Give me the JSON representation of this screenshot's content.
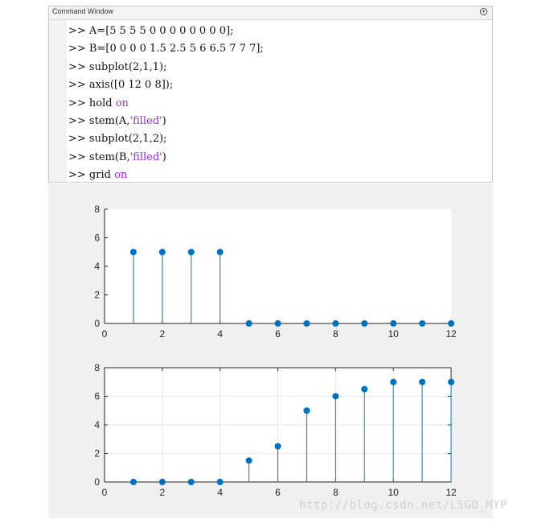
{
  "command_window": {
    "title": "Command Window",
    "menu_icon": "circle-chevron-down-icon",
    "prompt": ">>",
    "lines": [
      [
        {
          "t": "A=[5 5 5 5 0 0 0 0 0 0 0 0];",
          "c": "code"
        }
      ],
      [
        {
          "t": "B=[0 0 0 0 1.5 2.5 5 6 6.5 7 7 7];",
          "c": "code"
        }
      ],
      [
        {
          "t": "subplot(2,1,1);",
          "c": "code"
        }
      ],
      [
        {
          "t": "axis([0 12 0 8]);",
          "c": "code"
        }
      ],
      [
        {
          "t": "hold ",
          "c": "code"
        },
        {
          "t": "on",
          "c": "kw"
        }
      ],
      [
        {
          "t": "stem(A,",
          "c": "code"
        },
        {
          "t": "'filled'",
          "c": "str"
        },
        {
          "t": ")",
          "c": "code"
        }
      ],
      [
        {
          "t": "subplot(2,1,2);",
          "c": "code"
        }
      ],
      [
        {
          "t": "stem(B,",
          "c": "code"
        },
        {
          "t": "'filled'",
          "c": "str"
        },
        {
          "t": ")",
          "c": "code"
        }
      ],
      [
        {
          "t": "grid ",
          "c": "code"
        },
        {
          "t": "on",
          "c": "kw"
        }
      ]
    ]
  },
  "colors": {
    "stem": "#0072bd",
    "axes_bg": "#ffffff",
    "figure_bg": "#f0f0f0",
    "grid": "#e6e6e6",
    "axis": "#262626"
  },
  "chart_data": [
    {
      "type": "scatter",
      "subtype": "stem-filled",
      "title": "",
      "xlabel": "",
      "ylabel": "",
      "x": [
        1,
        2,
        3,
        4,
        5,
        6,
        7,
        8,
        9,
        10,
        11,
        12
      ],
      "values": [
        5,
        5,
        5,
        5,
        0,
        0,
        0,
        0,
        0,
        0,
        0,
        0
      ],
      "xlim": [
        0,
        12
      ],
      "ylim": [
        0,
        8
      ],
      "xticks": [
        "0",
        "2",
        "4",
        "6",
        "8",
        "10",
        "12"
      ],
      "yticks": [
        "0",
        "2",
        "4",
        "6",
        "8"
      ],
      "grid": false
    },
    {
      "type": "scatter",
      "subtype": "stem-filled",
      "title": "",
      "xlabel": "",
      "ylabel": "",
      "x": [
        1,
        2,
        3,
        4,
        5,
        6,
        7,
        8,
        9,
        10,
        11,
        12
      ],
      "values": [
        0,
        0,
        0,
        0,
        1.5,
        2.5,
        5,
        6,
        6.5,
        7,
        7,
        7
      ],
      "xlim": [
        0,
        12
      ],
      "ylim": [
        0,
        8
      ],
      "xticks": [
        "0",
        "2",
        "4",
        "6",
        "8",
        "10",
        "12"
      ],
      "yticks": [
        "0",
        "2",
        "4",
        "6",
        "8"
      ],
      "grid": true
    }
  ],
  "watermark": "http://blog.csdn.net/LSGO_MYP"
}
